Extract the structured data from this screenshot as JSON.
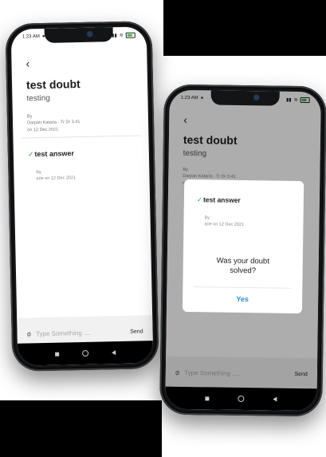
{
  "status": {
    "time": "1:23 AM"
  },
  "doubt": {
    "title": "test doubt",
    "description": "testing",
    "meta_by": "By",
    "meta_author": "Darpan Kataria - Tr Dr 3.41",
    "meta_date": "on 12 Dec 2021"
  },
  "answer": {
    "check": "✓",
    "title": "test answer",
    "meta_by": "By",
    "meta_author": "arie on 12 Dec 2021"
  },
  "input": {
    "placeholder": "Type Something ....",
    "send_label": "Send"
  },
  "modal": {
    "question": "Was your doubt solved?",
    "yes_label": "Yes"
  },
  "icons": {
    "back": "back-arrow-icon",
    "attach": "paperclip-icon",
    "nav_recents": "square-icon",
    "nav_home": "circle-icon",
    "nav_back": "triangle-back-icon"
  },
  "colors": {
    "accent": "#1f8fd6",
    "check": "#2aa84a"
  }
}
